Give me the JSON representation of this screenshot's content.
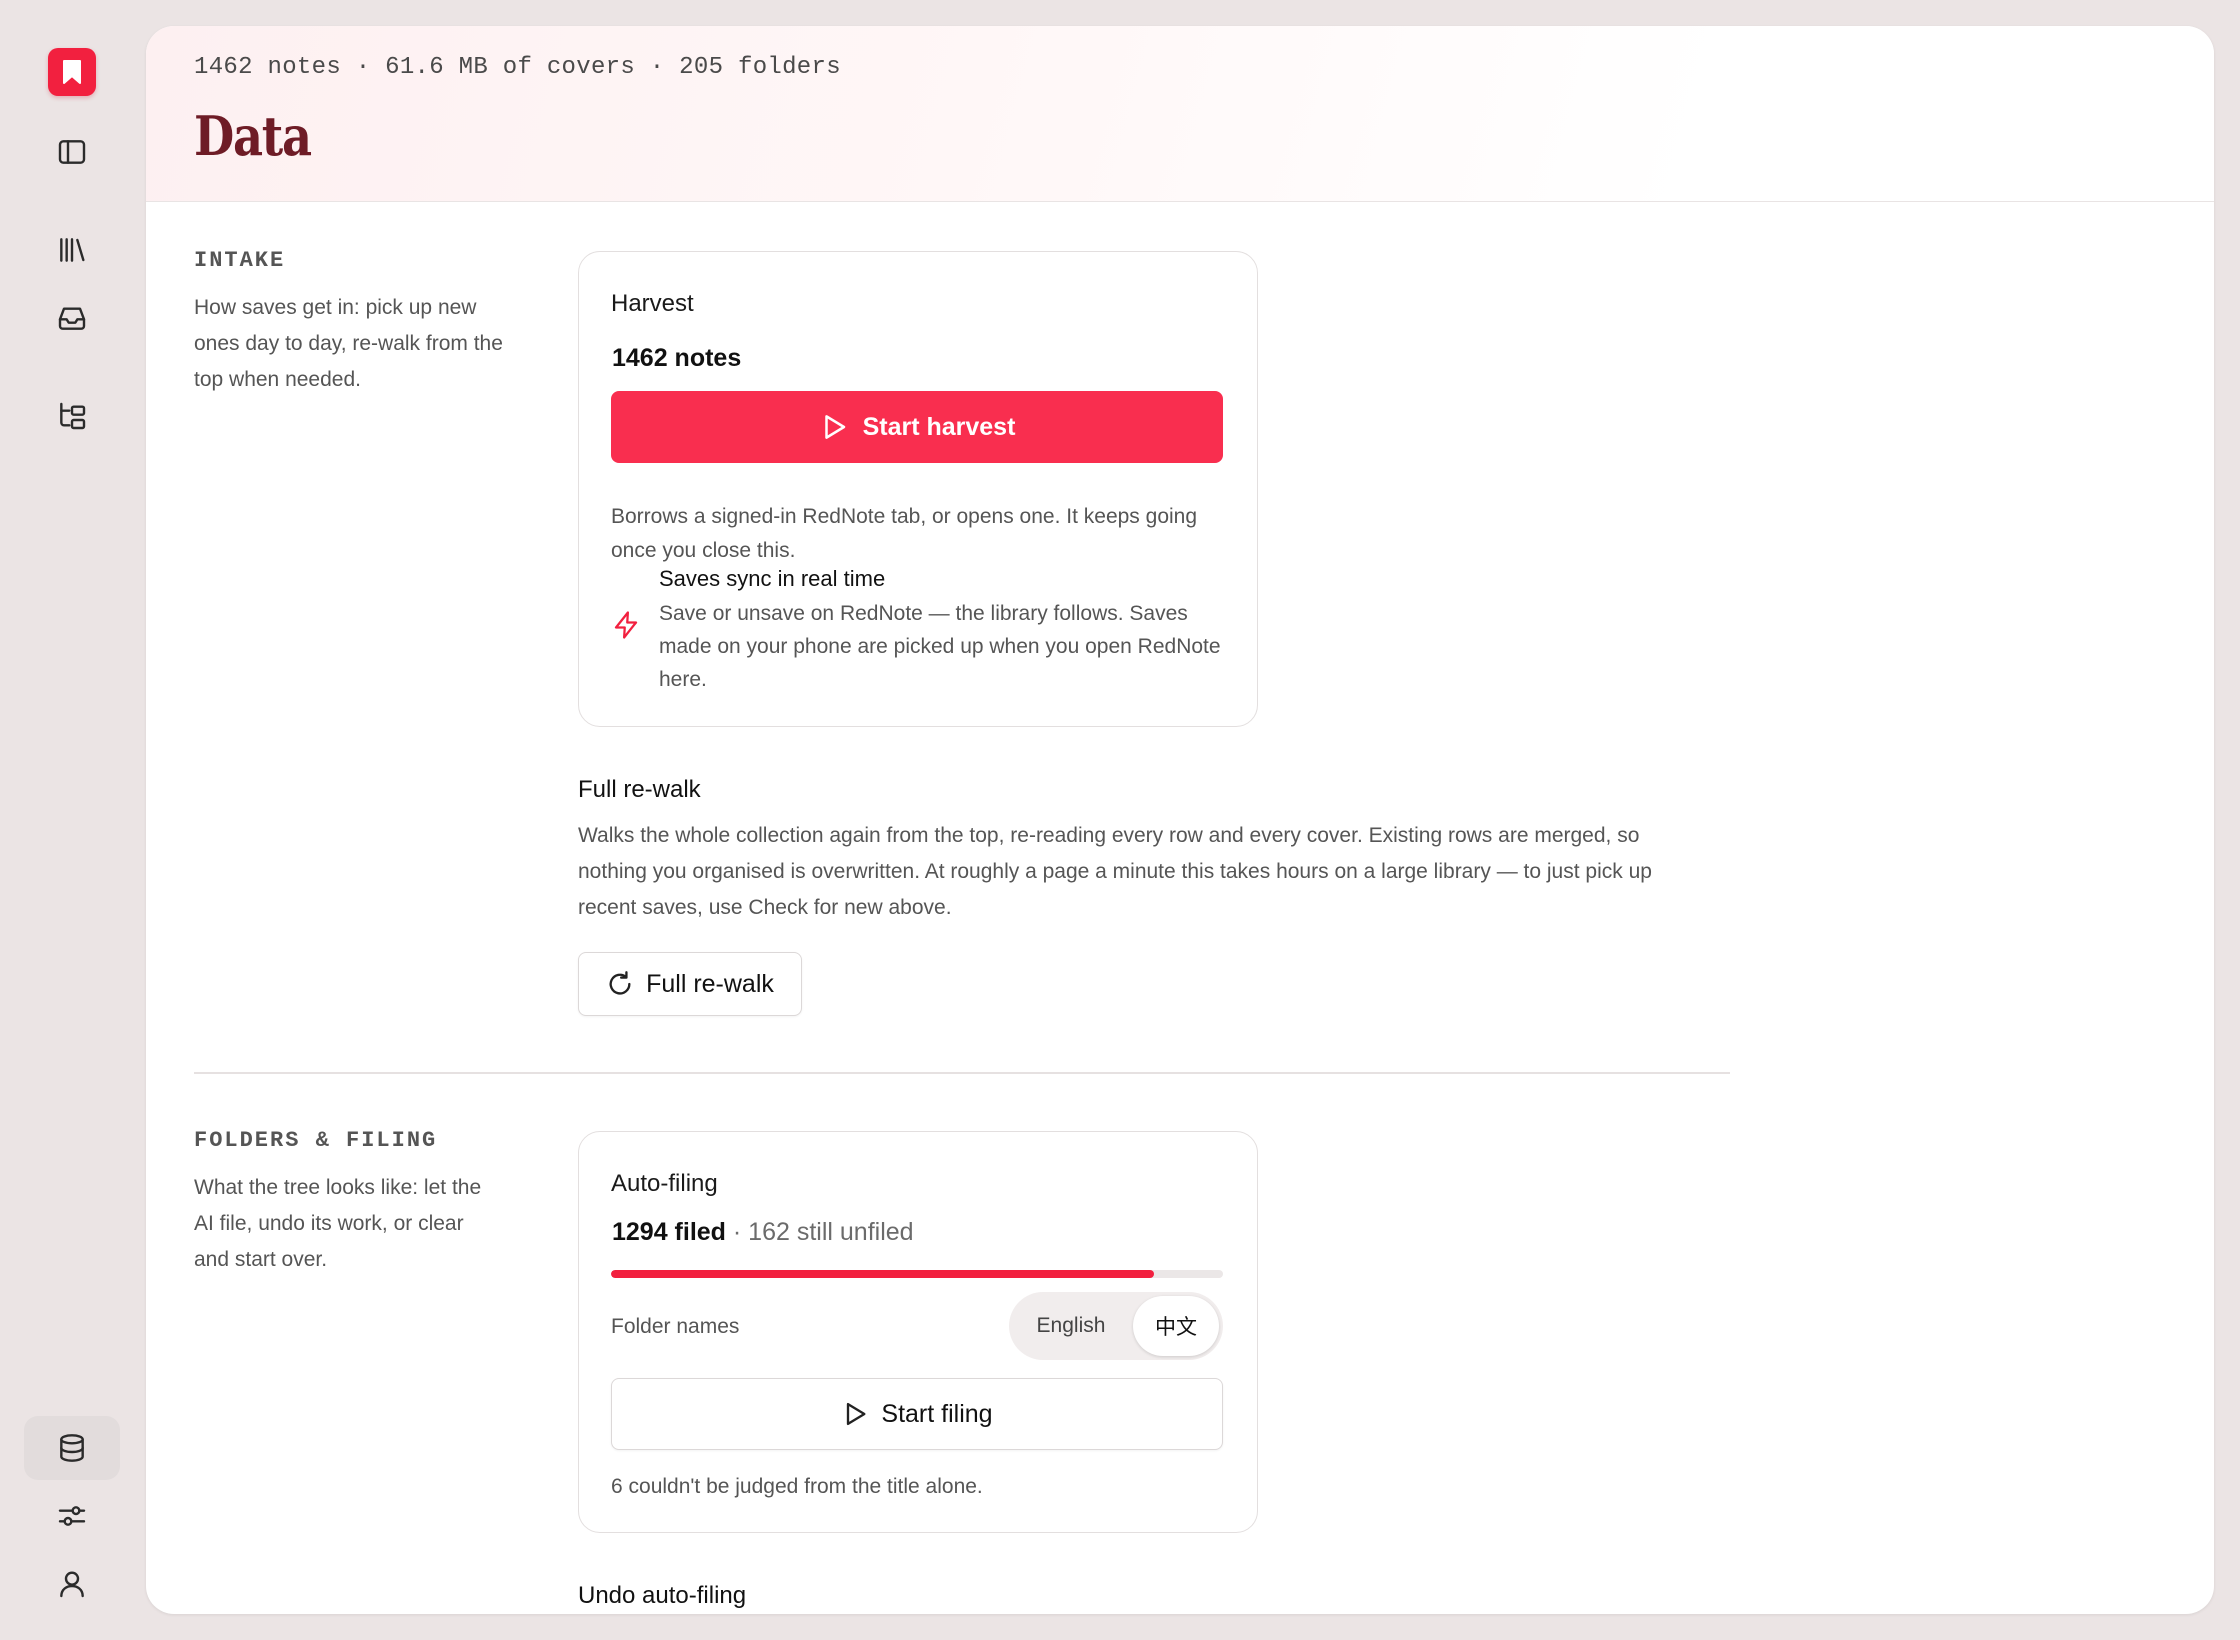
{
  "app": {
    "logo_icon": "bookmark-icon",
    "accent": "#f92e4f"
  },
  "rail": {
    "items": [
      {
        "name": "sidebar-toggle",
        "icon": "sidebar-icon"
      },
      {
        "name": "library",
        "icon": "library-icon"
      },
      {
        "name": "inbox",
        "icon": "inbox-icon"
      },
      {
        "name": "folders",
        "icon": "folder-tree-icon"
      },
      {
        "name": "data",
        "icon": "database-icon",
        "active": true
      },
      {
        "name": "settings",
        "icon": "sliders-icon"
      },
      {
        "name": "account",
        "icon": "user-icon"
      }
    ]
  },
  "header": {
    "meta": "1462 notes · 61.6 MB of covers · 205 folders",
    "title": "Data"
  },
  "intake": {
    "label": "INTAKE",
    "desc": "How saves get in: pick up new ones day to day, re-walk from the top when needed.",
    "harvest": {
      "title": "Harvest",
      "count": "1462 notes",
      "button": "Start harvest",
      "note": "Borrows a signed-in RedNote tab, or opens one. It keeps going once you close this.",
      "sync_title": "Saves sync in real time",
      "sync_desc": "Save or unsave on RedNote — the library follows. Saves made on your phone are picked up when you open RedNote here."
    },
    "rewalk": {
      "title": "Full re-walk",
      "desc": "Walks the whole collection again from the top, re-reading every row and every cover. Existing rows are merged, so nothing you organised is overwritten. At roughly a page a minute this takes hours on a large library — to just pick up recent saves, use Check for new above.",
      "button": "Full re-walk"
    }
  },
  "folders": {
    "label": "FOLDERS & FILING",
    "desc": "What the tree looks like: let the AI file, undo its work, or clear and start over.",
    "autofiling": {
      "title": "Auto-filing",
      "filed": "1294 filed",
      "unfiled": " · 162 still unfiled",
      "progress": 0.888,
      "names_label": "Folder names",
      "lang_options": [
        "English",
        "中文"
      ],
      "lang_selected": "中文",
      "button": "Start filing",
      "note": "6 couldn't be judged from the title alone."
    },
    "undo_title": "Undo auto-filing"
  }
}
